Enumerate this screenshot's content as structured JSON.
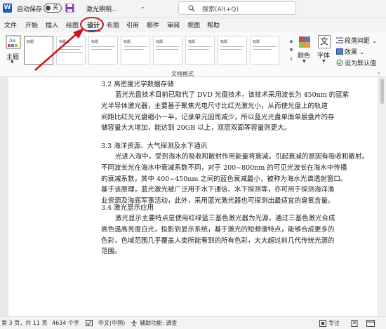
{
  "titlebar": {
    "autosave_label": "自动保存",
    "autosave_state": "关",
    "doc_title": "激光照明...",
    "search_placeholder": "搜索(Alt+Q)"
  },
  "tabs": [
    {
      "label": "文件"
    },
    {
      "label": "开始"
    },
    {
      "label": "插入"
    },
    {
      "label": "绘图"
    },
    {
      "label": "设计",
      "active": true
    },
    {
      "label": "布局"
    },
    {
      "label": "引用"
    },
    {
      "label": "邮件"
    },
    {
      "label": "审阅"
    },
    {
      "label": "视图"
    },
    {
      "label": "帮助"
    }
  ],
  "ribbon": {
    "theme_label": "主题",
    "style_thumbs": [
      {
        "title": "标题"
      },
      {
        "title": "标题 1"
      },
      {
        "title": "标题"
      },
      {
        "title": "标题"
      },
      {
        "title": "标题"
      },
      {
        "title": "标题"
      },
      {
        "title": "标题"
      },
      {
        "title": "标题"
      },
      {
        "title": "标题"
      }
    ],
    "colors_label": "颜色",
    "fonts_label": "字体",
    "font_icon_glyph": "文",
    "para_spacing_label": "段落间距",
    "effects_label": "效果",
    "set_default_label": "设为默认值",
    "group_label": "文档格式",
    "accent_colors": [
      "#c0504d",
      "#4f81bd",
      "#9bbb59",
      "#f79646"
    ]
  },
  "document": {
    "sections": [
      {
        "heading": "3.2 高密度光学数据存储",
        "lines": [
          "蓝光光盘技术目前已取代了 DVD 光盘技术，该技术采用波长为 450nm 的蓝紫",
          "光半导体激光器，主要基于聚焦光电尺寸比红光激光小，从而使光盘上的轨道",
          "间距比红光光盘缩小一半，记录单元因而减少，所以蓝光光盘单面单层盘片的存",
          "储容量大大增加，能达到 20GB 以上，双层双面等容量则更大。"
        ]
      },
      {
        "heading": "3.3 海洋资源、大气探测及水下通讯",
        "lines": [
          "光进入海中，受到海水的吸收和散射作用能量将衰减。引起衰减的原因有吸收和散射。",
          "不同波长光在海水中衰减系数不同，对于 200~800nm 的可见光波长在海水中传播",
          "的衰减系数，其中 400~450nm 之间的蓝色衰减最小，被称为海水光谱透射窗口。",
          "基于该原理，蓝光激光被广泛用于水下通信、水下探测等，亦可用于探测海洋渔",
          "业资源及海底军事活动，此外，采用蓝光激光器也可探测出最适宜的臭氧含量。"
        ]
      },
      {
        "heading": "3.4 激光显示应用",
        "lines": [
          "激光显示主要特点是使用红绿蓝三基色激光器为光源，通过三基色激光合成",
          "高色温高亮度白光，投影到显示系统，基于激光的短频谱特点，能够合成更多的",
          "色彩，色域范围几乎覆盖人类所能看到的所有色彩，大大超过前几代传统光源的",
          "范围。"
        ]
      }
    ]
  },
  "statusbar": {
    "page_info": "第 3 页，共 11 页",
    "word_count": "4634 个字",
    "language": "中文(中国)",
    "accessibility": "辅助功能: 调查",
    "focus": "专注"
  }
}
